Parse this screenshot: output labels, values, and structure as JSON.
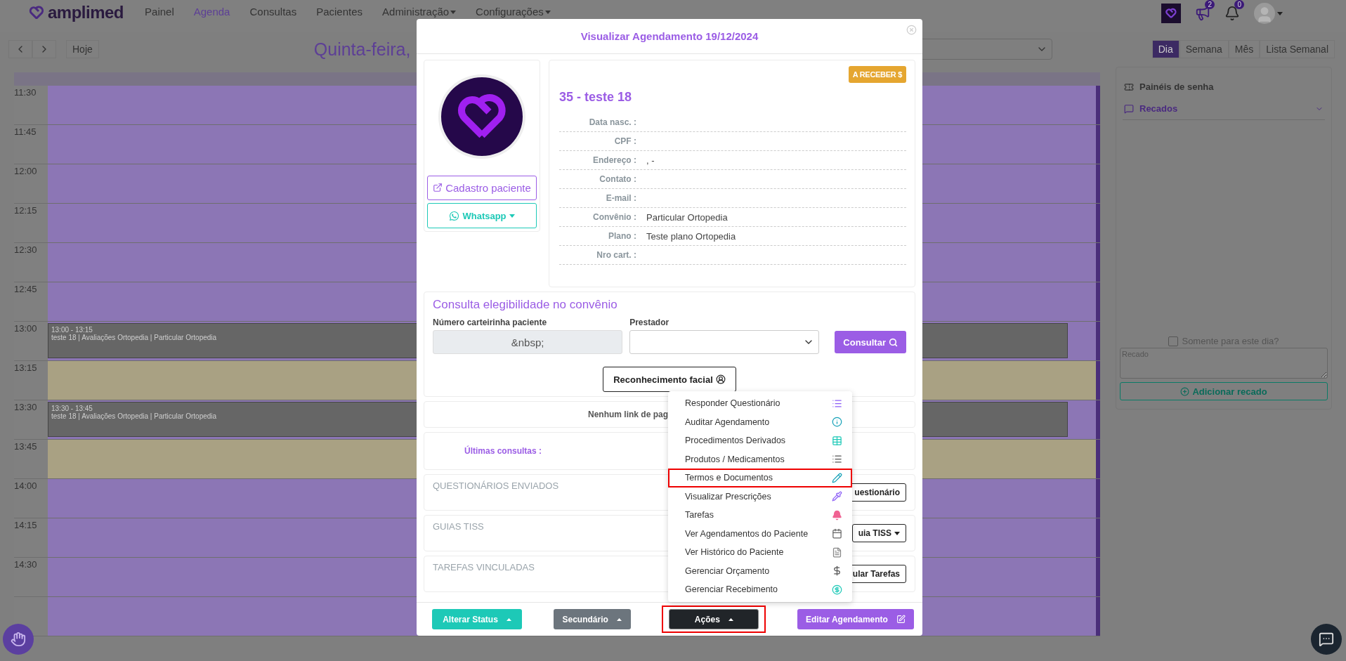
{
  "navbar": {
    "brand": "amplimed",
    "items": [
      {
        "label": "Painel",
        "selected": false,
        "has_menu": false
      },
      {
        "label": "Agenda",
        "selected": true,
        "has_menu": false
      },
      {
        "label": "Consultas",
        "selected": false,
        "has_menu": false
      },
      {
        "label": "Pacientes",
        "selected": false,
        "has_menu": false
      },
      {
        "label": "Administração",
        "selected": false,
        "has_menu": true
      },
      {
        "label": "Configurações",
        "selected": false,
        "has_menu": true
      }
    ],
    "badges": [
      "2",
      "0"
    ]
  },
  "toolbar": {
    "today": "Hoje",
    "title": "Quinta-feira,",
    "views": [
      {
        "label": "Dia",
        "selected": true
      },
      {
        "label": "Semana",
        "selected": false
      },
      {
        "label": "Mês",
        "selected": false
      },
      {
        "label": "Lista Semanal",
        "selected": false
      }
    ]
  },
  "calendar": {
    "slots": [
      {
        "time": "11:30",
        "kind": "booked"
      },
      {
        "time": "11:45",
        "kind": "booked"
      },
      {
        "time": "12:00",
        "kind": "booked"
      },
      {
        "time": "12:15",
        "kind": "booked"
      },
      {
        "time": "12:30",
        "kind": "booked"
      },
      {
        "time": "12:45",
        "kind": "booked"
      },
      {
        "time": "13:00",
        "kind": "booked",
        "event": {
          "range": "13:00 - 13:15",
          "text": "teste 18 | Avaliações Ortopedia | Particular Ortopedia"
        }
      },
      {
        "time": "13:15",
        "kind": "open"
      },
      {
        "time": "13:30",
        "kind": "booked",
        "event": {
          "range": "13:30 - 13:45",
          "text": "teste 18 | Avaliações Ortopedia | Particular Ortopedia"
        }
      },
      {
        "time": "13:45",
        "kind": "open"
      },
      {
        "time": "14:00",
        "kind": "booked"
      },
      {
        "time": "14:15",
        "kind": "booked"
      },
      {
        "time": "14:30",
        "kind": "booked"
      },
      {
        "kind": "booked"
      }
    ]
  },
  "side_panel": {
    "items": [
      "Painéis de senha",
      "Recados"
    ],
    "only_today": {
      "label": "Somente para este dia?",
      "checked": false
    },
    "message": {
      "placeholder": "Recado"
    },
    "add_button": "Adicionar recado"
  },
  "modal": {
    "title": "Visualizar Agendamento 19/12/2024",
    "patient": {
      "register_button": "Cadastro paciente",
      "whatsapp_button": "Whatsapp",
      "badge": "A RECEBER $",
      "name": "35 - teste 18",
      "fields": [
        {
          "label": "Data nasc. :"
        },
        {
          "label": "CPF :"
        },
        {
          "label": "Endereço :",
          "value": ", -"
        },
        {
          "label": "Contato :"
        },
        {
          "label": "E-mail :"
        },
        {
          "label": "Convênio :",
          "value": "Particular Ortopedia"
        },
        {
          "label": "Plano :",
          "value": "Teste plano Ortopedia"
        },
        {
          "label": "Nro cart. :"
        }
      ]
    },
    "eligibility": {
      "title": "Consulta elegibilidade no convênio",
      "card_label": "Número carteirinha paciente",
      "card_value": "&nbsp;",
      "provider_label": "Prestador",
      "consult_button": "Consultar",
      "face_button": "Reconhecimento facial"
    },
    "payment_link": "Nenhum link de pag",
    "last_visits": "Últimas consultas :",
    "sections": [
      {
        "title": "QUESTIONÁRIOS ENVIADOS",
        "button": "uestionário",
        "has_menu": false
      },
      {
        "title": "GUIAS TISS",
        "button": "uia TISS",
        "has_menu": true
      },
      {
        "title": "TAREFAS VINCULADAS",
        "button": "ular Tarefas",
        "has_menu": false
      }
    ],
    "footer": [
      {
        "label": "Alterar Status",
        "kind": "status",
        "highlighted": false
      },
      {
        "label": "Secundário",
        "kind": "secondary",
        "highlighted": false
      },
      {
        "label": "Ações",
        "kind": "actions",
        "highlighted": true
      },
      {
        "label": "Editar Agendamento",
        "kind": "edit",
        "highlighted": false
      }
    ],
    "menu": [
      {
        "label": "Responder Questionário",
        "highlighted": false
      },
      {
        "label": "Auditar Agendamento",
        "highlighted": false
      },
      {
        "label": "Procedimentos Derivados",
        "highlighted": false
      },
      {
        "label": "Produtos / Medicamentos",
        "highlighted": false
      },
      {
        "label": "Termos e Documentos",
        "highlighted": true
      },
      {
        "label": "Visualizar Prescrições",
        "highlighted": false
      },
      {
        "label": "Tarefas",
        "highlighted": false
      },
      {
        "label": "Ver Agendamentos do Paciente",
        "highlighted": false
      },
      {
        "label": "Ver Histórico do Paciente",
        "highlighted": false
      },
      {
        "label": "Gerenciar Orçamento",
        "highlighted": false
      },
      {
        "label": "Gerenciar Recebimento",
        "highlighted": false
      }
    ]
  }
}
